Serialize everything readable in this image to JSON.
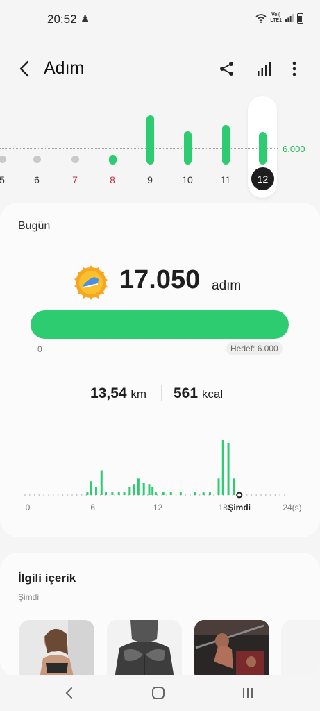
{
  "status_bar": {
    "time": "20:52",
    "notif_icon": "figure-icon",
    "lte_top": "Vo))",
    "lte_bottom": "LTE1"
  },
  "header": {
    "title": "Adım",
    "back_icon": "back-arrow-icon",
    "share_icon": "share-icon",
    "stats_icon": "bar-stats-icon",
    "more_icon": "more-vertical-icon"
  },
  "week": {
    "target_label": "6.000",
    "target_steps": 6000,
    "days": [
      {
        "label": "5",
        "steps": 0,
        "red": false
      },
      {
        "label": "6",
        "steps": 0,
        "red": false
      },
      {
        "label": "7",
        "steps": 0,
        "red": true
      },
      {
        "label": "8",
        "steps": 3400,
        "red": true
      },
      {
        "label": "9",
        "steps": 17800,
        "red": false
      },
      {
        "label": "10",
        "steps": 12000,
        "red": false
      },
      {
        "label": "11",
        "steps": 14300,
        "red": false
      },
      {
        "label": "12",
        "steps": 11700,
        "red": false,
        "selected": true
      }
    ]
  },
  "today": {
    "title": "Bugün",
    "steps": "17.050",
    "unit": "adım",
    "progress_fraction": 1.0,
    "progress_min": "0",
    "goal_label": "Hedef: 6.000",
    "distance_value": "13,54",
    "distance_unit": "km",
    "calories_value": "561",
    "calories_unit": "kcal",
    "accent_color": "#2ecc71"
  },
  "hourly_chart": {
    "x_ticks": [
      "0",
      "6",
      "12",
      "18",
      "Şimdi",
      "24(s)"
    ],
    "bars": [
      [
        5.5,
        0.05
      ],
      [
        5.8,
        0.25
      ],
      [
        6.3,
        0.15
      ],
      [
        6.8,
        0.45
      ],
      [
        7.2,
        0.05
      ],
      [
        7.8,
        0.05
      ],
      [
        8.4,
        0.05
      ],
      [
        8.9,
        0.05
      ],
      [
        9.4,
        0.15
      ],
      [
        9.8,
        0.2
      ],
      [
        10.2,
        0.3
      ],
      [
        10.7,
        0.22
      ],
      [
        11.2,
        0.2
      ],
      [
        11.5,
        0.15
      ],
      [
        11.8,
        0.05
      ],
      [
        12.5,
        0.05
      ],
      [
        13.2,
        0.05
      ],
      [
        14.1,
        0.05
      ],
      [
        15.4,
        0.05
      ],
      [
        16.2,
        0.05
      ],
      [
        16.8,
        0.05
      ],
      [
        17.6,
        0.3
      ],
      [
        18.0,
        1.0
      ],
      [
        18.5,
        0.95
      ],
      [
        19.0,
        0.3
      ]
    ],
    "now_hour": 19.5
  },
  "related": {
    "title": "İlgili içerik",
    "subtitle": "Şimdi"
  },
  "navbar": {
    "back": "nav-back-icon",
    "home": "nav-home-icon",
    "recents": "nav-recents-icon"
  }
}
